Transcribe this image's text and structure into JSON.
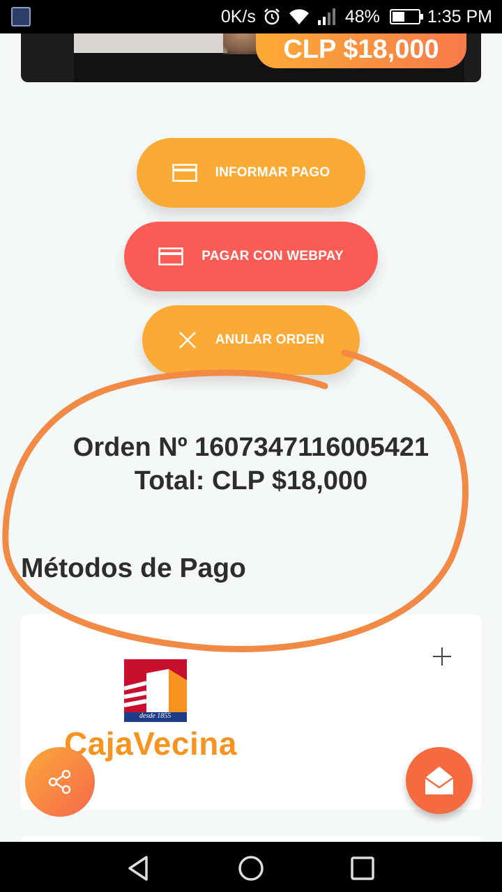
{
  "status_bar": {
    "speed": "0K/s",
    "battery": "48%",
    "battery_level": 0.48,
    "time": "1:35 PM"
  },
  "hero": {
    "price": "CLP $18,000"
  },
  "actions": {
    "informar_pago": "INFORMAR PAGO",
    "pagar_webpay": "PAGAR CON WEBPAY",
    "anular_orden": "ANULAR ORDEN"
  },
  "order": {
    "number_line": "Orden Nº 1607347116005421",
    "total_line": "Total: CLP $18,000"
  },
  "payment_methods": {
    "title": "Métodos de Pago",
    "items": [
      {
        "name": "CajaVecina",
        "badge": "desde 1855"
      }
    ]
  },
  "colors": {
    "orange": "#fcaa36",
    "red": "#fa5b55",
    "annotation": "#f08a45"
  },
  "icons": {
    "informar": "card-icon",
    "webpay": "card-icon",
    "anular": "close-icon",
    "expand": "plus-icon",
    "share": "share-icon",
    "mail": "mail-icon"
  }
}
